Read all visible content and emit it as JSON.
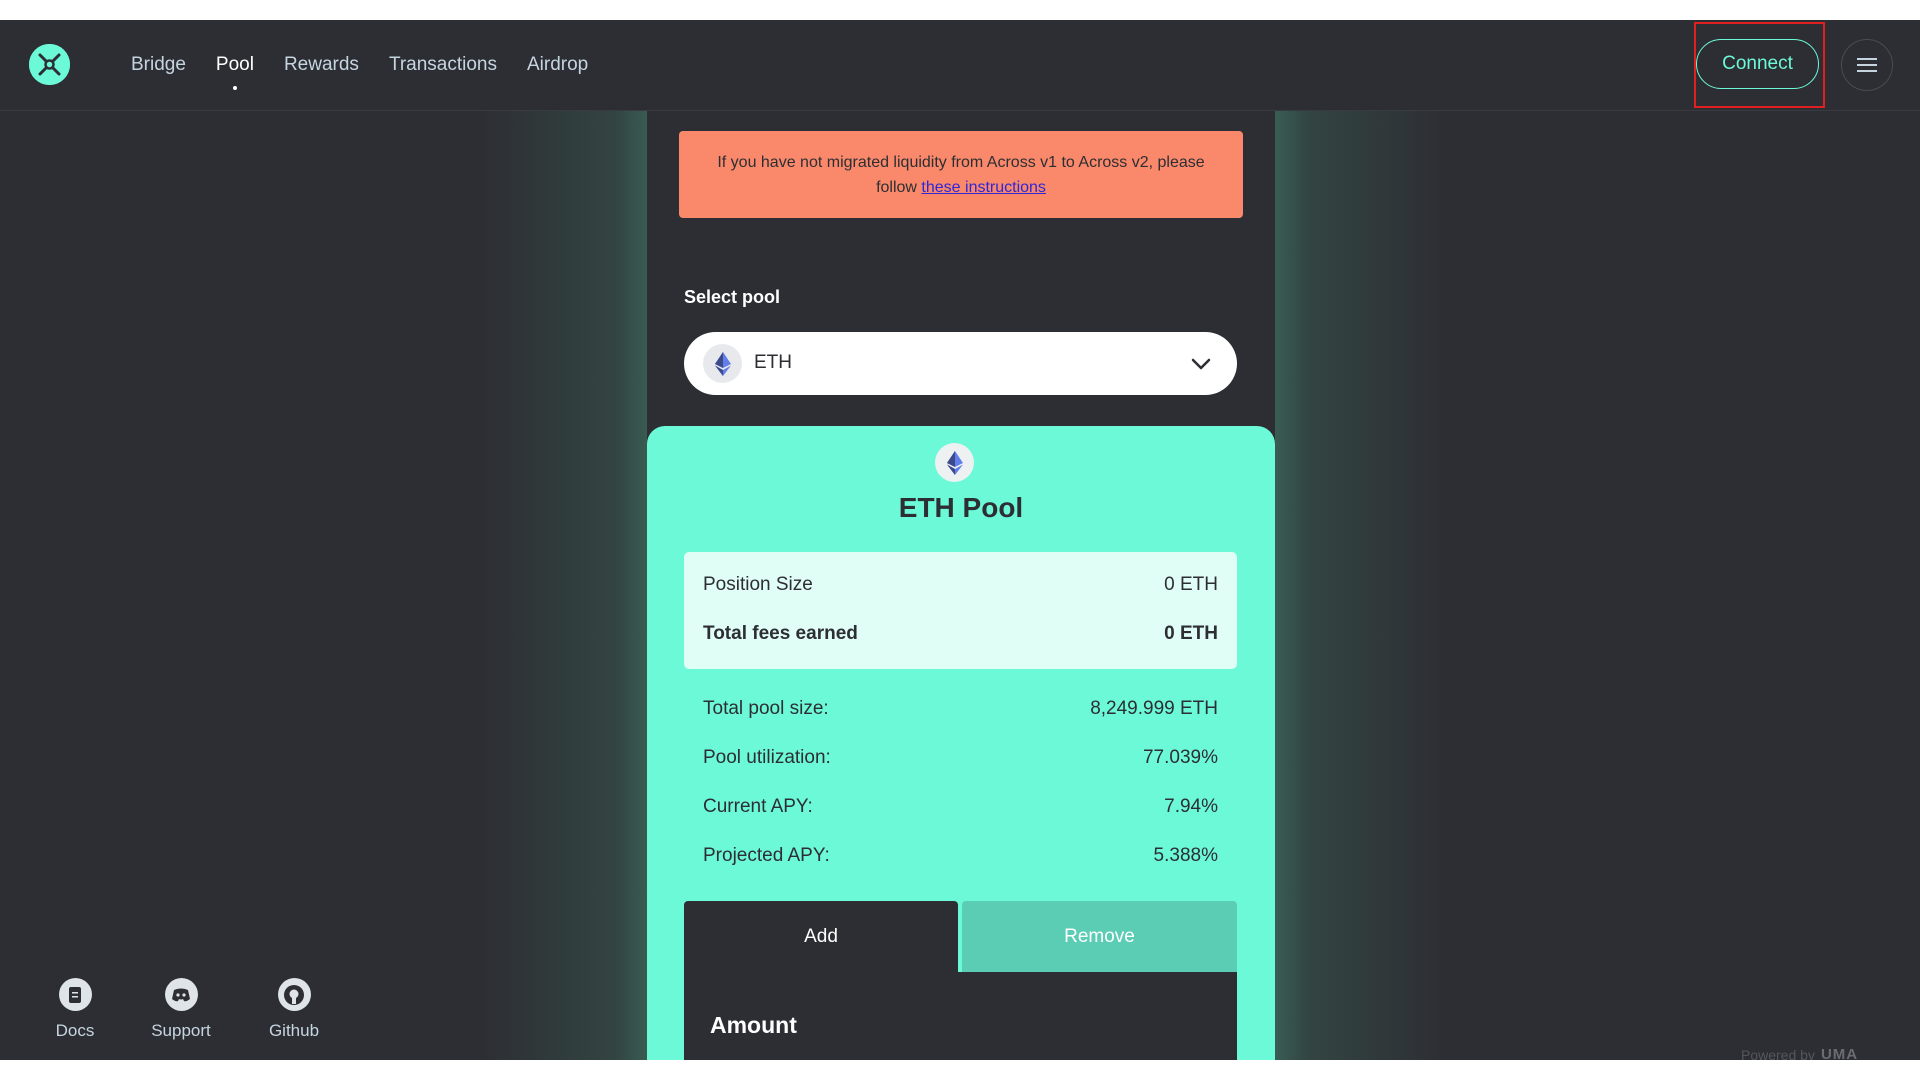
{
  "header": {
    "nav": [
      "Bridge",
      "Pool",
      "Rewards",
      "Transactions",
      "Airdrop"
    ],
    "active_nav": "Pool",
    "connect_label": "Connect"
  },
  "banner": {
    "text": "If you have not migrated liquidity from Across v1 to Across v2, please follow",
    "link": "these instructions"
  },
  "select_pool": {
    "label": "Select pool",
    "value": "ETH"
  },
  "pool": {
    "title": "ETH Pool",
    "position_size_label": "Position Size",
    "position_size_value": "0 ETH",
    "fees_label": "Total fees earned",
    "fees_value": "0 ETH",
    "stats": [
      {
        "label": "Total pool size:",
        "value": "8,249.999 ETH"
      },
      {
        "label": "Pool utilization:",
        "value": "77.039%"
      },
      {
        "label": "Current APY:",
        "value": "7.94%"
      },
      {
        "label": "Projected APY:",
        "value": "5.388%"
      }
    ],
    "tabs": {
      "add": "Add",
      "remove": "Remove"
    },
    "amount_label": "Amount"
  },
  "footer": {
    "links": [
      "Docs",
      "Support",
      "Github"
    ],
    "powered_by": "Powered by",
    "brand": "UMA"
  },
  "colors": {
    "accent": "#6cf9d8",
    "background": "#2d2e33",
    "banner": "#f9896a"
  }
}
